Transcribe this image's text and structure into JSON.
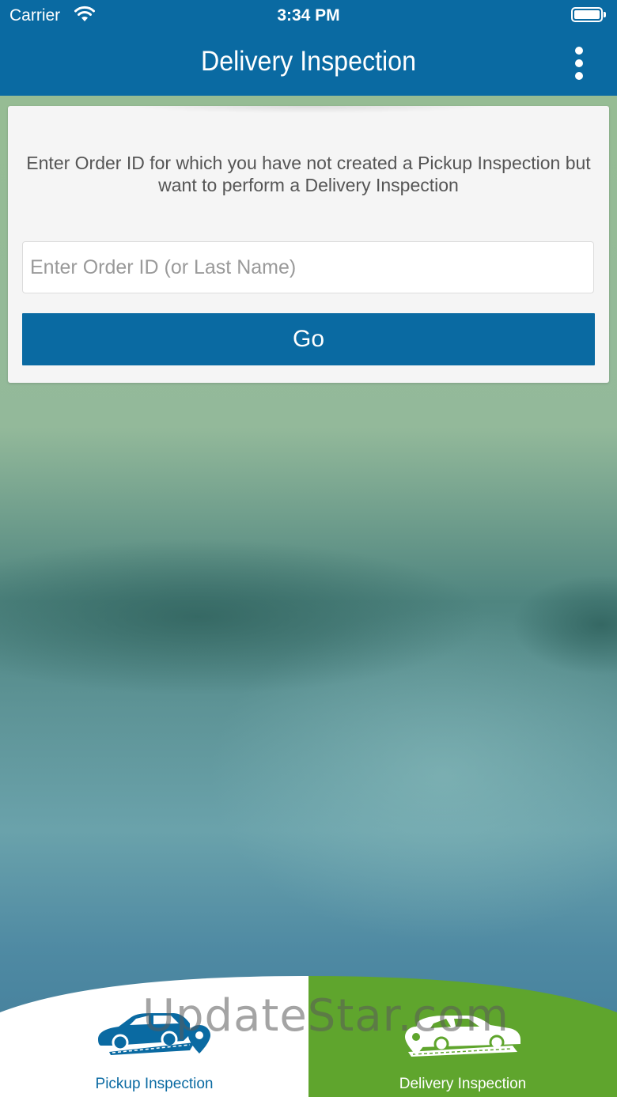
{
  "status_bar": {
    "carrier": "Carrier",
    "time": "3:34 PM",
    "wifi_icon": "wifi-icon",
    "battery_icon": "battery-icon"
  },
  "nav_bar": {
    "title": "Delivery Inspection",
    "menu_icon": "more-vertical-icon"
  },
  "order_card": {
    "instructions": "Enter Order ID for which you have not created a Pickup Inspection but want to perform a Delivery Inspection",
    "input_value": "",
    "input_placeholder": "Enter Order ID (or Last Name)",
    "go_label": "Go"
  },
  "tab_bar": {
    "tabs": [
      {
        "label": "Pickup Inspection",
        "icon": "car-pickup-icon",
        "active": false
      },
      {
        "label": "Delivery Inspection",
        "icon": "car-delivery-icon",
        "active": true
      }
    ]
  },
  "watermark": "UpdateStar.com",
  "colors": {
    "primary_blue": "#0a6aa2",
    "active_green": "#5fa52d",
    "card_bg": "#f5f5f5"
  }
}
